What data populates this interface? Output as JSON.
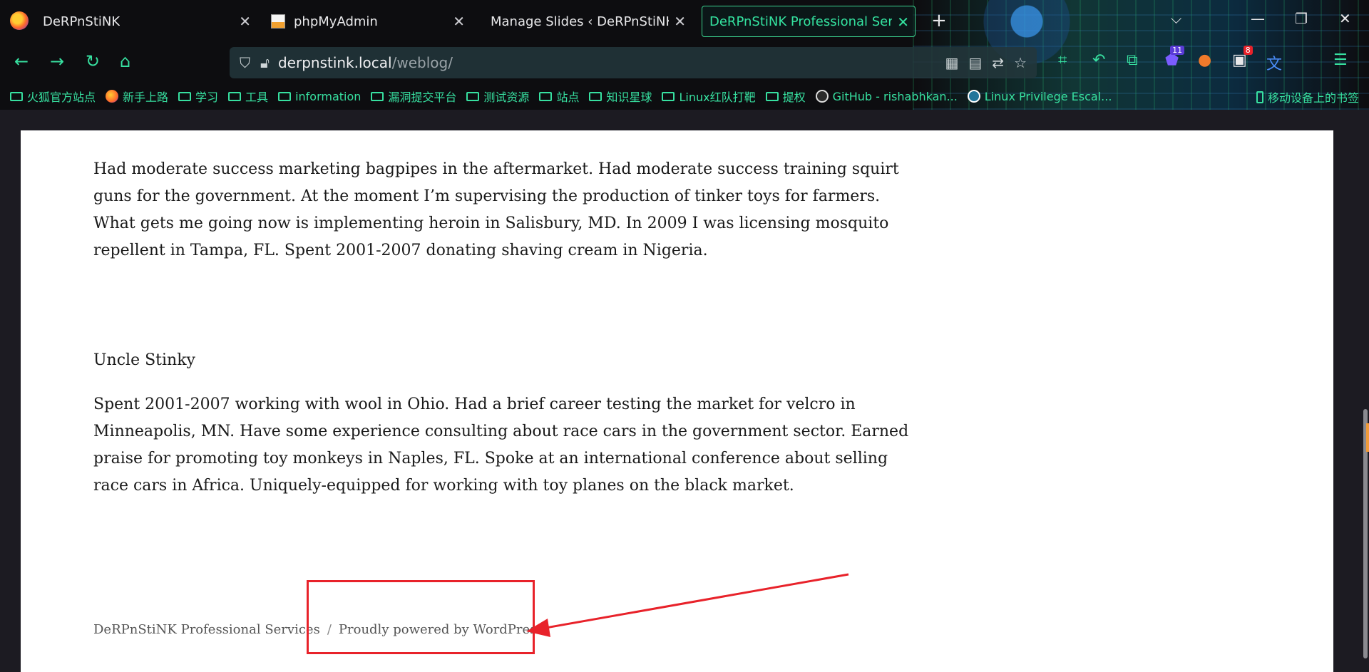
{
  "tabs": [
    {
      "title": "DeRPnStiNK",
      "favicon": "firefox-page-icon"
    },
    {
      "title": "phpMyAdmin",
      "favicon": "phpmyadmin-icon"
    },
    {
      "title": "Manage Slides ‹ DeRPnStiNK Pro",
      "favicon": "none"
    },
    {
      "title": "DeRPnStiNK Professional Service",
      "favicon": "none",
      "active": true
    }
  ],
  "url": {
    "host": "derpnstink.local",
    "path": "/weblog/"
  },
  "extensions": [
    {
      "name": "crop-icon",
      "badge": ""
    },
    {
      "name": "undo-icon",
      "badge": ""
    },
    {
      "name": "extension-icon",
      "badge": ""
    },
    {
      "name": "shield-extension-icon",
      "badge": "11"
    },
    {
      "name": "fox-extension-icon",
      "badge": ""
    },
    {
      "name": "mail-extension-icon",
      "badge": "8"
    },
    {
      "name": "translate-icon",
      "badge": ""
    }
  ],
  "bookmarks": [
    {
      "label": "火狐官方站点",
      "icon": "folder-icon"
    },
    {
      "label": "新手上路",
      "icon": "firefox-icon"
    },
    {
      "label": "学习",
      "icon": "folder-icon"
    },
    {
      "label": "工具",
      "icon": "folder-icon"
    },
    {
      "label": "information",
      "icon": "folder-icon"
    },
    {
      "label": "漏洞提交平台",
      "icon": "folder-icon"
    },
    {
      "label": "测试资源",
      "icon": "folder-icon"
    },
    {
      "label": "站点",
      "icon": "folder-icon"
    },
    {
      "label": "知识星球",
      "icon": "folder-icon"
    },
    {
      "label": "Linux红队打靶",
      "icon": "folder-icon"
    },
    {
      "label": "提权",
      "icon": "folder-icon"
    },
    {
      "label": "GitHub - rishabhkan...",
      "icon": "github-icon"
    },
    {
      "label": "Linux Privilege Escal...",
      "icon": "wordpress-icon"
    }
  ],
  "mobile_bookmarks": "移动设备上的书签",
  "content": {
    "para1": "Had moderate success marketing bagpipes in the aftermarket. Had moderate success training squirt guns for the government. At the moment I’m supervising the production of tinker toys for farmers. What gets me going now is implementing heroin in Salisbury, MD. In 2009 I was licensing mosquito repellent in Tampa, FL. Spent 2001-2007 donating shaving cream in Nigeria.",
    "heading": "Uncle Stinky",
    "para2": "Spent 2001-2007 working with wool in Ohio. Had a brief career testing the market for velcro in Minneapolis, MN. Have some experience consulting about race cars in the government sector. Earned praise for promoting toy monkeys in Naples, FL. Spoke at an international conference about selling race cars in Africa. Uniquely-equipped for working with toy planes on the black market."
  },
  "footer": {
    "site_name": "DeRPnStiNK Professional Services",
    "separator": "/",
    "powered": "Proudly powered by WordPress"
  },
  "colors": {
    "accent": "#37e0a0",
    "annotation": "#e8222a"
  }
}
